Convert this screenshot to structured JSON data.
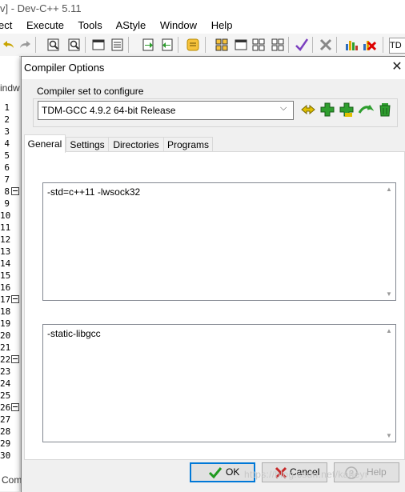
{
  "ide": {
    "title": "v] - Dev-C++ 5.11",
    "menu": [
      "ect",
      "Execute",
      "Tools",
      "AStyle",
      "Window",
      "Help"
    ],
    "editor_tab_fragment": "indw",
    "line_numbers": [
      "1",
      "2",
      "3",
      "4",
      "5",
      "6",
      "7",
      "8",
      "9",
      "10",
      "11",
      "12",
      "13",
      "14",
      "15",
      "16",
      "17",
      "18",
      "19",
      "20",
      "21",
      "22",
      "23",
      "24",
      "25",
      "26",
      "27",
      "28",
      "29",
      "30"
    ],
    "status_fragment": "Com",
    "toolbar_right_label": "TD"
  },
  "dialog": {
    "title": "Compiler Options",
    "close_glyph": "✕",
    "compiler_set_label": "Compiler set to configure",
    "compiler_set_value": "TDM-GCC 4.9.2 64-bit Release",
    "tabs": [
      "General",
      "Settings",
      "Directories",
      "Programs"
    ],
    "active_tab": "General",
    "compile_commands": "-std=c++11 -lwsock32",
    "linker_commands": "-static-libgcc",
    "buttons": {
      "ok": "OK",
      "cancel": "Cancel",
      "help": "Help"
    }
  },
  "watermark": "https://blog.csdn.net/kaheyr",
  "colors": {
    "accent": "#0078d7",
    "panel": "#f0f0f0",
    "green_icon": "#2e9e2e"
  }
}
